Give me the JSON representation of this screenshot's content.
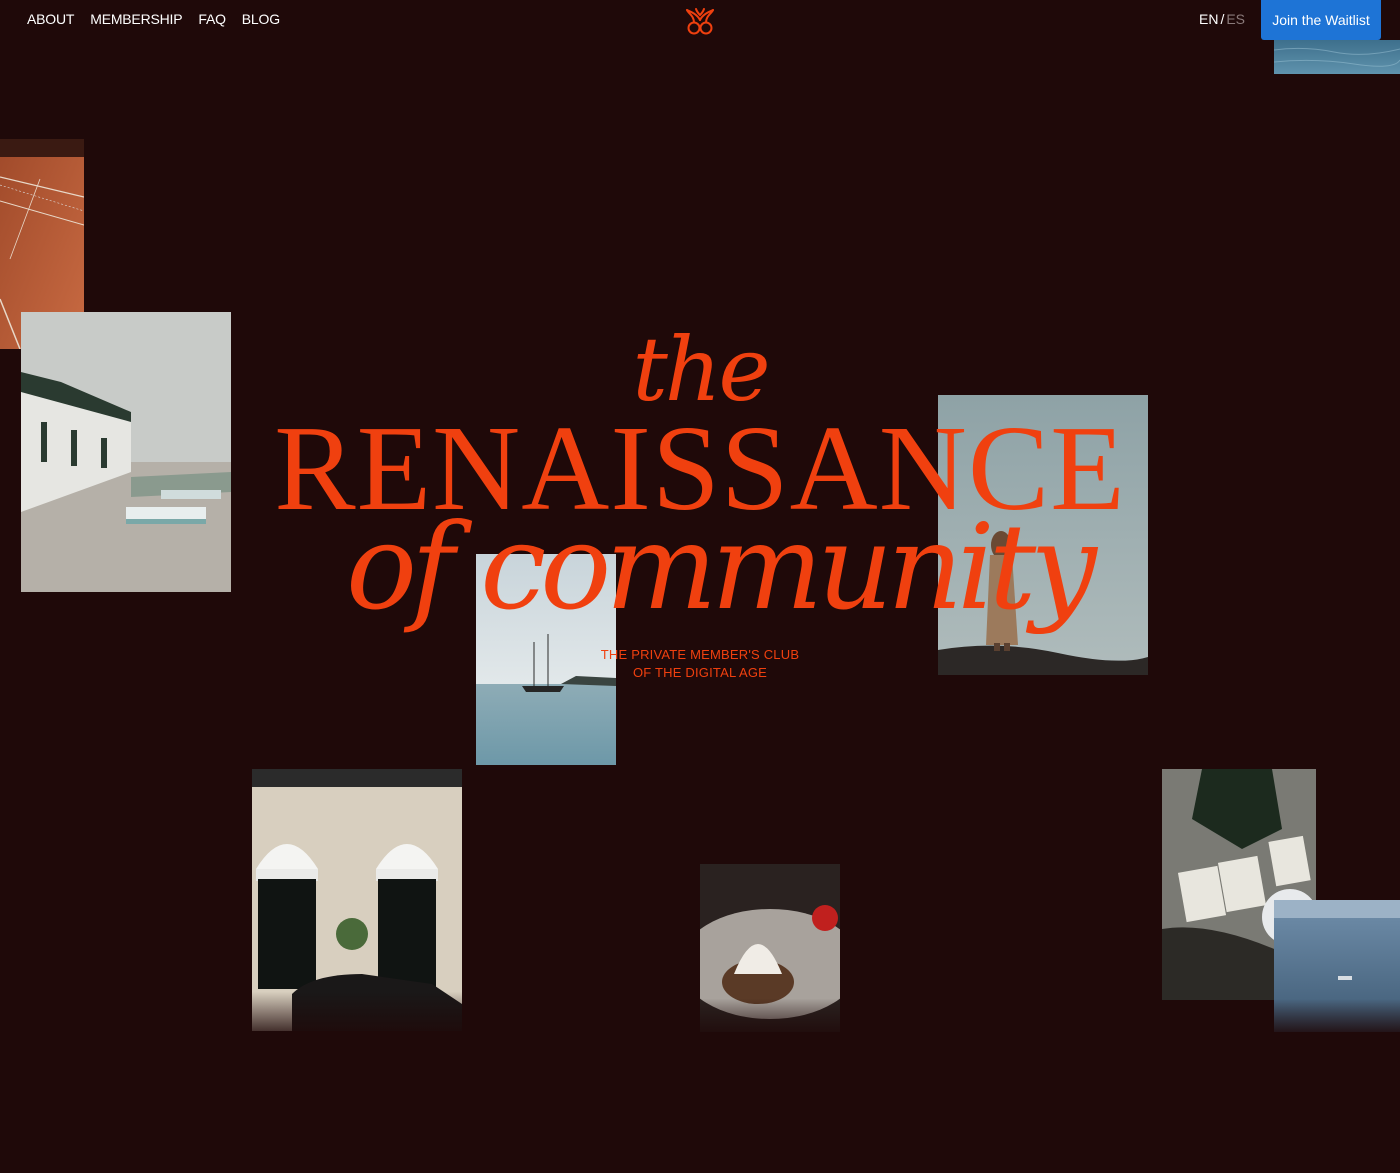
{
  "nav": {
    "items": [
      {
        "label": "ABOUT"
      },
      {
        "label": "MEMBERSHIP"
      },
      {
        "label": "FAQ"
      },
      {
        "label": "BLOG"
      }
    ]
  },
  "logo": {
    "icon": "club-monogram-icon"
  },
  "language": {
    "current": "EN",
    "separator": "/",
    "other": "ES"
  },
  "cta": {
    "label": "Join the Waitlist"
  },
  "hero": {
    "line1": "the",
    "line2": "RENAISSANCE",
    "line3": "of community",
    "tagline1": "THE PRIVATE MEMBER'S CLUB",
    "tagline2": "OF THE DIGITAL AGE"
  },
  "colors": {
    "background": "#1f0909",
    "accent": "#f0400f",
    "cta": "#1e74d6"
  }
}
